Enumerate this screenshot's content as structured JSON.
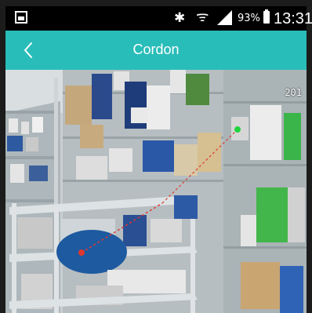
{
  "status_bar": {
    "gallery_icon": "image-icon",
    "bluetooth_icon": "bluetooth-icon",
    "bluetooth_glyph": "✱",
    "wifi_icon": "wifi-icon",
    "wifi_glyph": "ᯤ",
    "signal_icon": "cell-signal-icon",
    "battery_percent": "93%",
    "battery_icon": "battery-icon",
    "time": "13:31"
  },
  "header": {
    "title": "Cordon",
    "back_icon": "chevron-left-icon",
    "background": "#29bdb9"
  },
  "camera": {
    "timestamp": "201",
    "line_color": "#e0382f",
    "start_point_color": "#e0382f",
    "end_point_color": "#1fd43c"
  }
}
